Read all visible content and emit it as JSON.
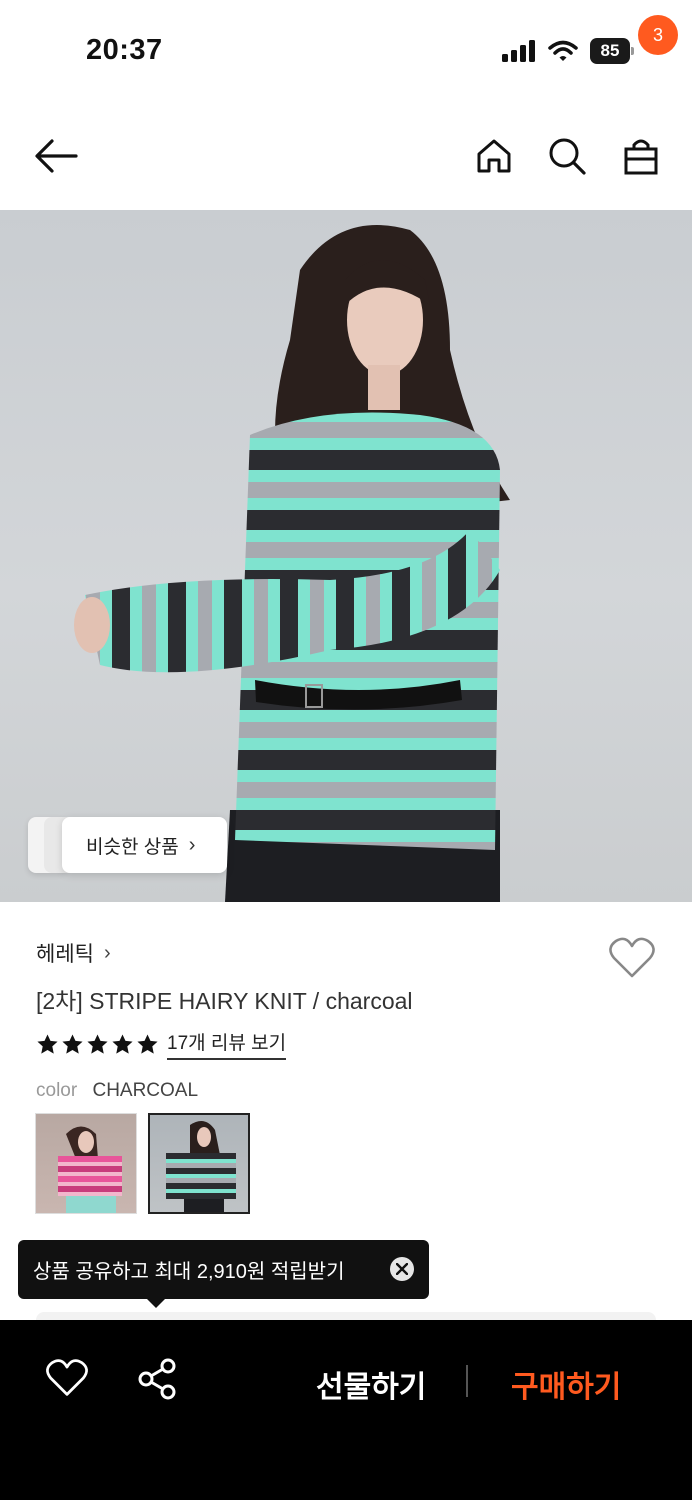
{
  "status_bar": {
    "time": "20:37",
    "battery": "85"
  },
  "nav": {
    "cart_count": "3"
  },
  "hero": {
    "similar_label": "비슷한 상품",
    "chevron": "›"
  },
  "product": {
    "brand": "헤레틱",
    "title": "[2차] STRIPE HAIRY KNIT / charcoal",
    "rating_stars": 5,
    "review_link": "17개 리뷰 보기",
    "color_label": "color",
    "color_value": "CHARCOAL",
    "swatches": [
      "pink-stripe",
      "charcoal-stripe"
    ],
    "selected_swatch": 1
  },
  "tooltip": {
    "text": "상품 공유하고 최대 2,910원 적립받기"
  },
  "bottom_bar": {
    "gift_label": "선물하기",
    "buy_label": "구매하기"
  },
  "colors": {
    "accent": "#ff5a1f",
    "stripe_mint": "#7fe3cf",
    "stripe_charcoal": "#2b2c30",
    "stripe_grey": "#a7aab0"
  },
  "icons": [
    "back-arrow-icon",
    "home-icon",
    "search-icon",
    "shopping-bag-icon",
    "heart-icon",
    "star-icon",
    "share-icon",
    "close-icon"
  ]
}
